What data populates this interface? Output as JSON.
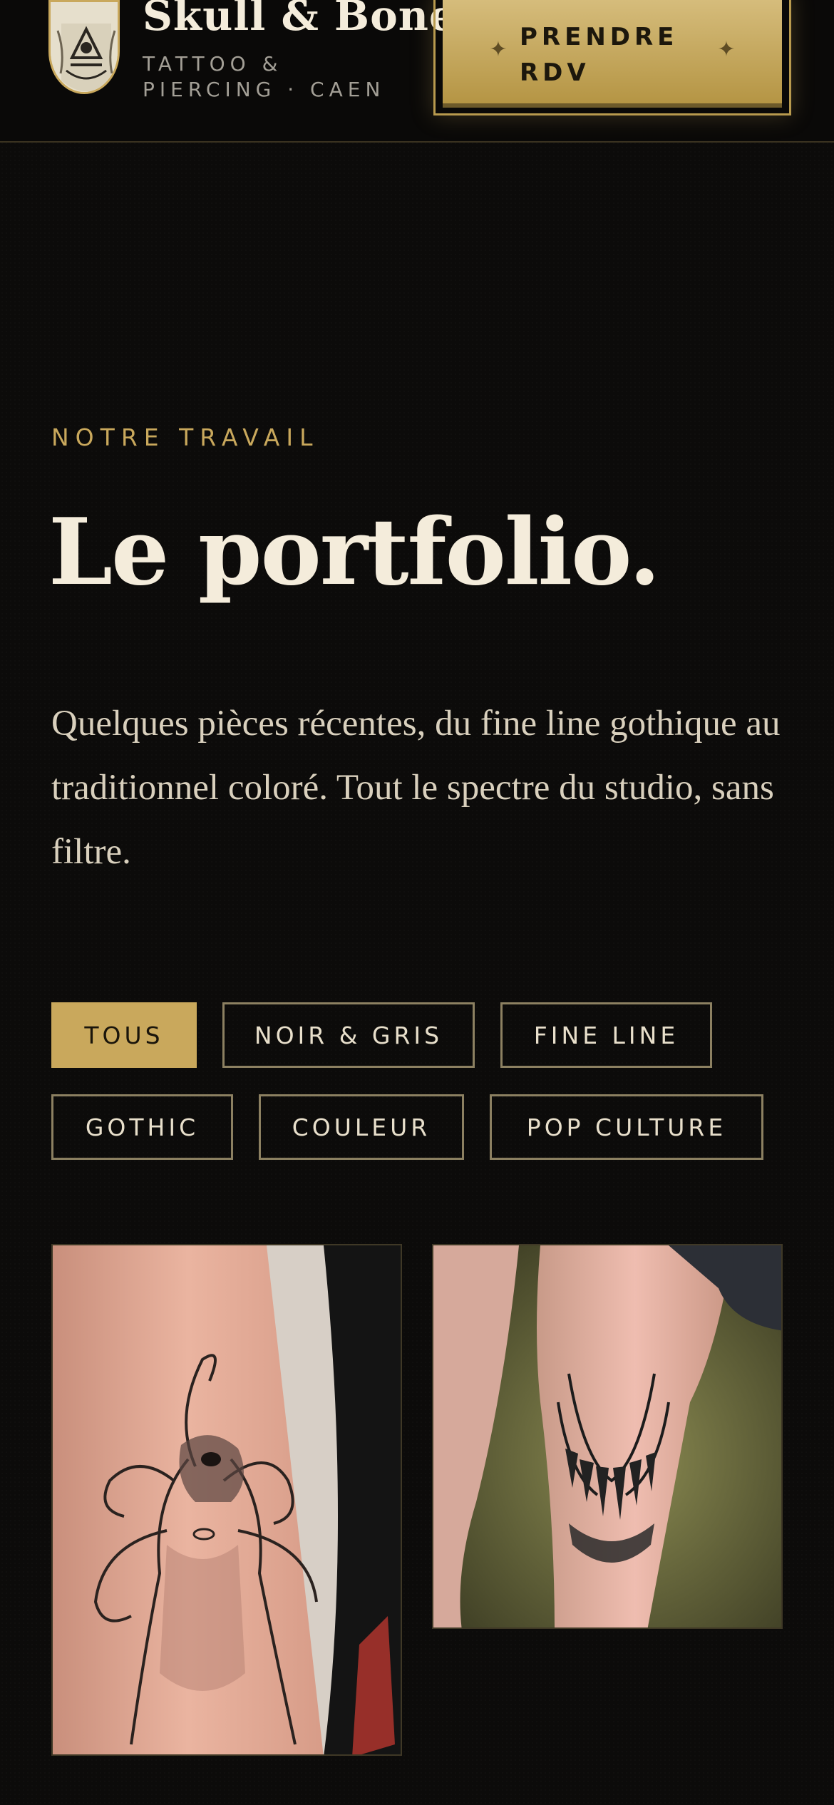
{
  "header": {
    "brand_name": "Skull & Bones",
    "brand_sub": "TATTOO & PIERCING · CAEN",
    "cta_label": "PRENDRE RDV",
    "cta_star": "✦"
  },
  "hero": {
    "eyebrow": "NOTRE TRAVAIL",
    "title": "Le portfolio.",
    "lead": "Quelques pièces récentes, du fine line gothique au traditionnel coloré. Tout le spectre du studio, sans filtre."
  },
  "filters": [
    {
      "label": "TOUS",
      "active": true
    },
    {
      "label": "NOIR & GRIS",
      "active": false
    },
    {
      "label": "FINE LINE",
      "active": false
    },
    {
      "label": "GOTHIC",
      "active": false
    },
    {
      "label": "COULEUR",
      "active": false
    },
    {
      "label": "POP CULTURE",
      "active": false
    }
  ],
  "gallery": [
    {
      "subject": "forearm tattoo — tentacled creature",
      "icon": "photo-icon"
    },
    {
      "subject": "knee tattoo — fanged jaws",
      "icon": "photo-icon"
    }
  ],
  "colors": {
    "background": "#0c0b0a",
    "gold": "#c9a85c",
    "cream": "#f4ecdb",
    "muted": "#a39f96"
  }
}
